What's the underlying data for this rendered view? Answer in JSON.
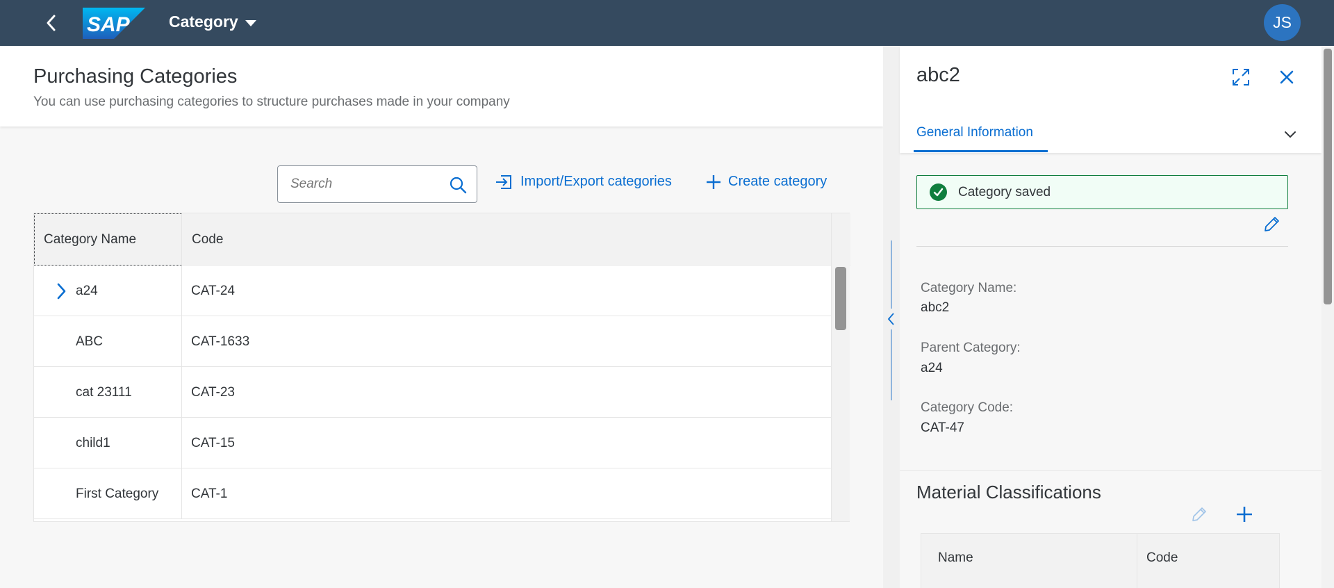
{
  "shell": {
    "logo_text": "SAP",
    "app_title": "Category",
    "avatar_initials": "JS"
  },
  "page": {
    "title": "Purchasing Categories",
    "subtitle": "You can use purchasing categories to structure purchases made in your company"
  },
  "toolbar": {
    "search_placeholder": "Search",
    "import_export_label": "Import/Export categories",
    "create_label": "Create category"
  },
  "table": {
    "columns": [
      "Category Name",
      "Code"
    ],
    "rows": [
      {
        "name": "a24",
        "code": "CAT-24",
        "expandable": true
      },
      {
        "name": "ABC",
        "code": "CAT-1633",
        "expandable": false
      },
      {
        "name": "cat 23111",
        "code": "CAT-23",
        "expandable": false
      },
      {
        "name": "child1",
        "code": "CAT-15",
        "expandable": false
      },
      {
        "name": "First Category",
        "code": "CAT-1",
        "expandable": false
      }
    ]
  },
  "panel": {
    "title": "abc2",
    "tab_label": "General Information",
    "message": "Category saved",
    "fields": [
      {
        "label": "Category Name:",
        "value": "abc2"
      },
      {
        "label": "Parent Category:",
        "value": "a24"
      },
      {
        "label": "Category Code:",
        "value": "CAT-47"
      }
    ],
    "section2": {
      "title": "Material Classifications",
      "columns": [
        "Name",
        "Code"
      ]
    }
  },
  "colors": {
    "shell_bg": "#354a5f",
    "accent": "#0a6ed1",
    "success": "#107e3e",
    "avatar_bg": "#2c74c0"
  }
}
